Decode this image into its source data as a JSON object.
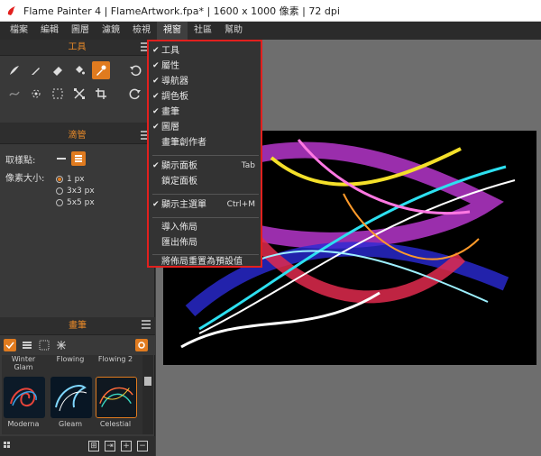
{
  "window": {
    "title": "Flame Painter 4 | FlameArtwork.fpa* | 1600 x 1000 像素 | 72 dpi"
  },
  "menubar": {
    "items": [
      "檔案",
      "編輯",
      "圖層",
      "濾鏡",
      "檢視",
      "視窗",
      "社區",
      "幫助"
    ],
    "active": "視窗"
  },
  "panels": {
    "tools": {
      "title": "工具"
    },
    "brush_tool": {
      "title": "滴管",
      "sample_label": "取樣點:",
      "pixel_size_label": "像素大小:",
      "options": [
        "1 px",
        "3x3 px",
        "5x5 px"
      ],
      "selected": "1 px"
    },
    "brushes": {
      "title": "畫筆",
      "top_labels": [
        "Winter Glam",
        "Flowing",
        "Flowing 2"
      ],
      "presets": [
        "Moderna",
        "Gleam",
        "Celestial"
      ]
    }
  },
  "window_menu": {
    "items": [
      {
        "label": "工具",
        "checked": true,
        "shortcut": ""
      },
      {
        "label": "屬性",
        "checked": true,
        "shortcut": ""
      },
      {
        "label": "導航器",
        "checked": true,
        "shortcut": ""
      },
      {
        "label": "調色板",
        "checked": true,
        "shortcut": ""
      },
      {
        "label": "畫筆",
        "checked": true,
        "shortcut": ""
      },
      {
        "label": "圖層",
        "checked": true,
        "shortcut": ""
      },
      {
        "label": "畫筆創作者",
        "checked": false,
        "shortcut": ""
      },
      {
        "label": "顯示面板",
        "checked": true,
        "shortcut": "Tab"
      },
      {
        "label": "鎖定面板",
        "checked": false,
        "shortcut": ""
      },
      {
        "label": "顯示主選單",
        "checked": true,
        "shortcut": "Ctrl+M"
      },
      {
        "label": "導入佈局",
        "checked": false,
        "shortcut": ""
      },
      {
        "label": "匯出佈局",
        "checked": false,
        "shortcut": ""
      },
      {
        "label": "將佈局重置為預設值",
        "checked": false,
        "shortcut": ""
      }
    ]
  },
  "colors": {
    "accent": "#e07b1f",
    "highlight_border": "#e2201e"
  }
}
